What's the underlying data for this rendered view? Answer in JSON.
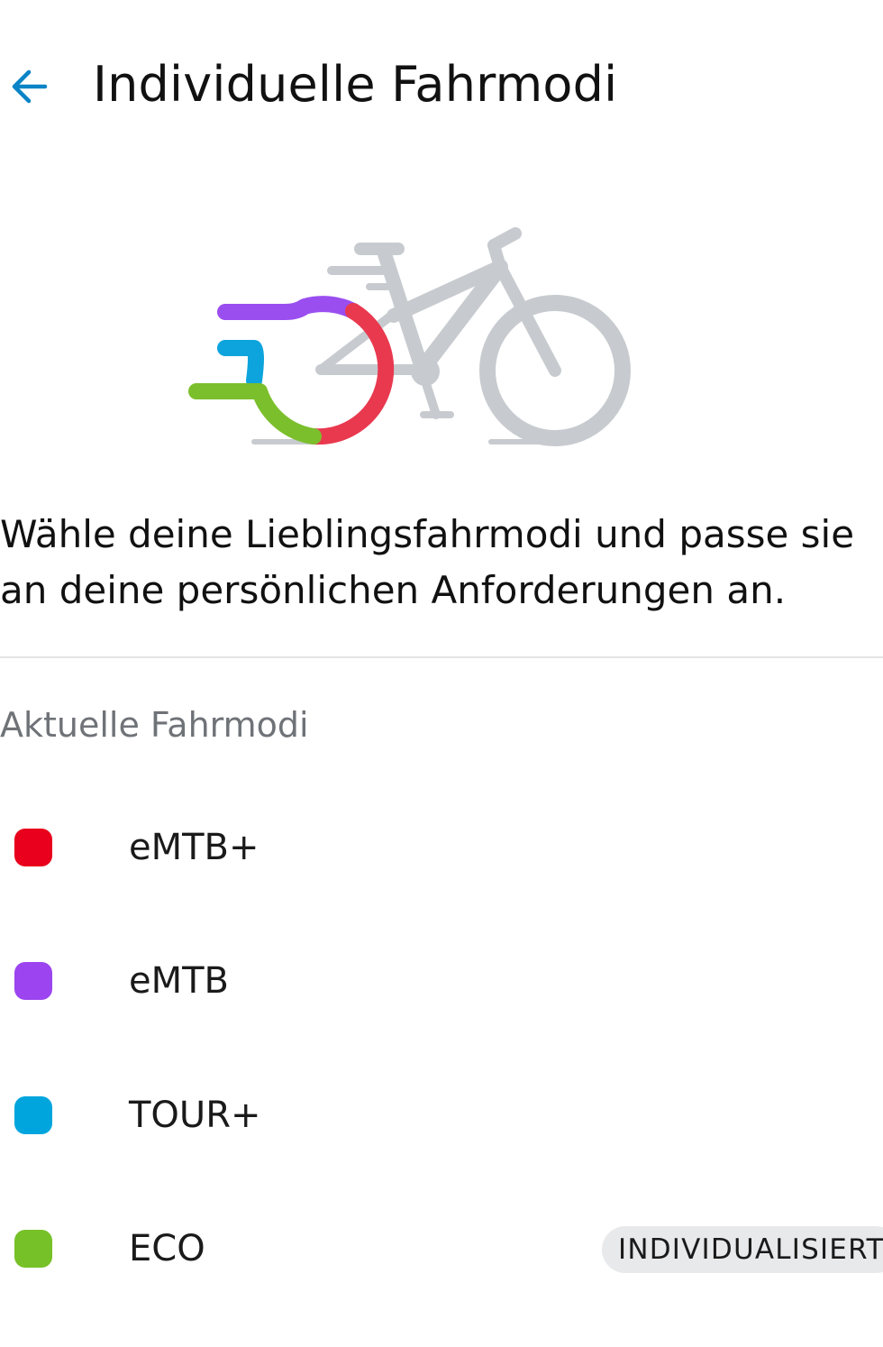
{
  "header": {
    "back_icon": "arrow-left-icon",
    "title": "Individuelle Fahrmodi"
  },
  "illustration": {
    "icon": "ebike-mode-illustration",
    "colors": {
      "bike": "#c7cbcf",
      "red": "#e9394f",
      "purple": "#9a4ef0",
      "blue": "#0da4dd",
      "green": "#7bbf2c"
    }
  },
  "intro": {
    "line1": "Wähle deine Lieblingsfahrmodi und passe sie",
    "line2": "an deine persönlichen Anforderungen an."
  },
  "section": {
    "label": "Aktuelle Fahrmodi"
  },
  "modes": [
    {
      "label": "eMTB+",
      "color": "#e8001c"
    },
    {
      "label": "eMTB",
      "color": "#9b44ef"
    },
    {
      "label": "TOUR+",
      "color": "#00a5de"
    },
    {
      "label": "ECO",
      "color": "#76c127",
      "badge": "INDIVIDUALISIERT"
    }
  ],
  "theme": {
    "accent": "#0a84c6",
    "divider": "#e3e4e6",
    "badge_bg": "#e8e9eb"
  }
}
